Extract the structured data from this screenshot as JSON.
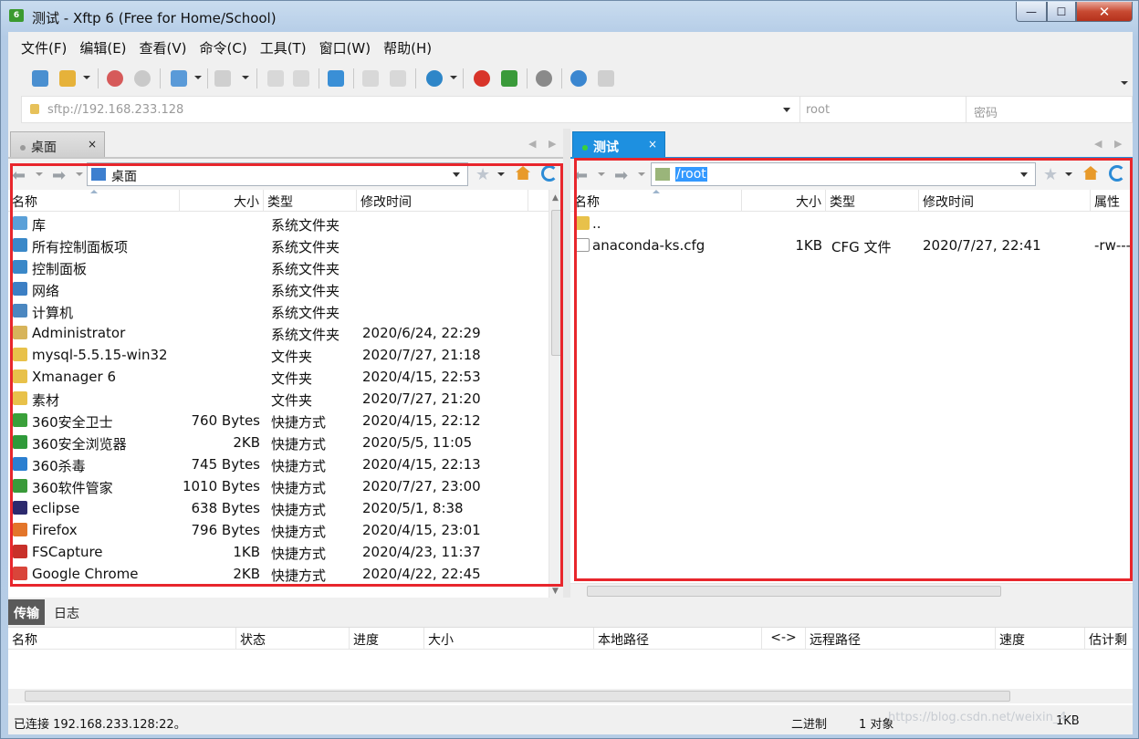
{
  "window": {
    "title": "测试 - Xftp 6 (Free for Home/School)",
    "app_icon_text": "6"
  },
  "window_buttons": {
    "minimize": "—",
    "maximize": "☐",
    "close": "✕"
  },
  "menu": [
    "文件(F)",
    "编辑(E)",
    "查看(V)",
    "命令(C)",
    "工具(T)",
    "窗口(W)",
    "帮助(H)"
  ],
  "address": {
    "url": "sftp://192.168.233.128",
    "user_placeholder": "root",
    "password_placeholder": "密码"
  },
  "left": {
    "tab_label": "桌面",
    "tab_close": "×",
    "path": "桌面",
    "columns": [
      "名称",
      "大小",
      "类型",
      "修改时间"
    ],
    "rows": [
      {
        "name": "库",
        "size": "",
        "type": "系统文件夹",
        "mtime": "",
        "icon": "library-icon",
        "color": "#5aa0d8"
      },
      {
        "name": "所有控制面板项",
        "size": "",
        "type": "系统文件夹",
        "mtime": "",
        "icon": "control-panel-icon",
        "color": "#3a88c8"
      },
      {
        "name": "控制面板",
        "size": "",
        "type": "系统文件夹",
        "mtime": "",
        "icon": "control-panel-icon",
        "color": "#3a88c8"
      },
      {
        "name": "网络",
        "size": "",
        "type": "系统文件夹",
        "mtime": "",
        "icon": "network-icon",
        "color": "#3c7fc4"
      },
      {
        "name": "计算机",
        "size": "",
        "type": "系统文件夹",
        "mtime": "",
        "icon": "computer-icon",
        "color": "#4b87c0"
      },
      {
        "name": "Administrator",
        "size": "",
        "type": "系统文件夹",
        "mtime": "2020/6/24, 22:29",
        "icon": "user-folder-icon",
        "color": "#d7b45a"
      },
      {
        "name": "mysql-5.5.15-win32",
        "size": "",
        "type": "文件夹",
        "mtime": "2020/7/27, 21:18",
        "icon": "folder-icon",
        "color": "#e8c14a"
      },
      {
        "name": "Xmanager 6",
        "size": "",
        "type": "文件夹",
        "mtime": "2020/4/15, 22:53",
        "icon": "folder-icon",
        "color": "#e8c14a"
      },
      {
        "name": "素材",
        "size": "",
        "type": "文件夹",
        "mtime": "2020/7/27, 21:20",
        "icon": "folder-icon",
        "color": "#e8c14a"
      },
      {
        "name": "360安全卫士",
        "size": "760 Bytes",
        "type": "快捷方式",
        "mtime": "2020/4/15, 22:12",
        "icon": "shortcut-icon",
        "color": "#3aa03a"
      },
      {
        "name": "360安全浏览器",
        "size": "2KB",
        "type": "快捷方式",
        "mtime": "2020/5/5, 11:05",
        "icon": "shortcut-icon",
        "color": "#2f9a3a"
      },
      {
        "name": "360杀毒",
        "size": "745 Bytes",
        "type": "快捷方式",
        "mtime": "2020/4/15, 22:13",
        "icon": "shortcut-icon",
        "color": "#2b7fd0"
      },
      {
        "name": "360软件管家",
        "size": "1010 Bytes",
        "type": "快捷方式",
        "mtime": "2020/7/27, 23:00",
        "icon": "shortcut-icon",
        "color": "#3a9a3a"
      },
      {
        "name": "eclipse",
        "size": "638 Bytes",
        "type": "快捷方式",
        "mtime": "2020/5/1, 8:38",
        "icon": "shortcut-icon",
        "color": "#2c2a6e"
      },
      {
        "name": "Firefox",
        "size": "796 Bytes",
        "type": "快捷方式",
        "mtime": "2020/4/15, 23:01",
        "icon": "shortcut-icon",
        "color": "#e3752a"
      },
      {
        "name": "FSCapture",
        "size": "1KB",
        "type": "快捷方式",
        "mtime": "2020/4/23, 11:37",
        "icon": "shortcut-icon",
        "color": "#c8302a"
      },
      {
        "name": "Google Chrome",
        "size": "2KB",
        "type": "快捷方式",
        "mtime": "2020/4/22, 22:45",
        "icon": "shortcut-icon",
        "color": "#d9453a"
      }
    ]
  },
  "right": {
    "tab_label": "测试",
    "tab_close": "×",
    "path": "/root",
    "columns": [
      "名称",
      "大小",
      "类型",
      "修改时间",
      "属性"
    ],
    "rows": [
      {
        "name": "..",
        "size": "",
        "type": "",
        "mtime": "",
        "attr": "",
        "icon": "folder-icon",
        "color": "#e8c14a"
      },
      {
        "name": "anaconda-ks.cfg",
        "size": "1KB",
        "type": "CFG 文件",
        "mtime": "2020/7/27, 22:41",
        "attr": "-rw---",
        "icon": "file-icon",
        "color": "#ffffff"
      }
    ]
  },
  "transfer": {
    "tabs": [
      "传输",
      "日志"
    ],
    "columns": [
      "名称",
      "状态",
      "进度",
      "大小",
      "本地路径",
      "<->",
      "远程路径",
      "速度",
      "估计剩"
    ]
  },
  "status": {
    "connection": "已连接 192.168.233.128:22。",
    "mode": "二进制",
    "objects": "1 对象",
    "size": "1KB",
    "watermark": "https://blog.csdn.net/weixin_4..."
  },
  "colors": {
    "accent": "#1e90e0",
    "highlight_box": "#e8262c",
    "selection": "#3399ff"
  }
}
